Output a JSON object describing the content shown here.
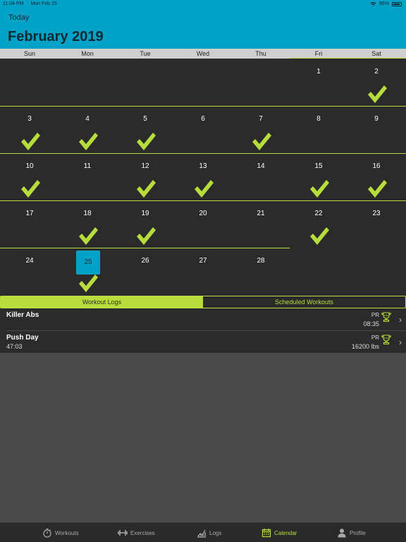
{
  "status_bar": {
    "time": "11:04 PM",
    "date": "Mon Feb 25",
    "battery": "86%",
    "battery_level": 0.86
  },
  "header": {
    "today_label": "Today",
    "month_title": "February 2019"
  },
  "calendar": {
    "weekdays": [
      "Sun",
      "Mon",
      "Tue",
      "Wed",
      "Thu",
      "Fri",
      "Sat"
    ],
    "first_weekday_index": 5,
    "days_in_month": 28,
    "today": 25,
    "completed_days": [
      2,
      3,
      4,
      5,
      7,
      10,
      12,
      13,
      15,
      16,
      18,
      19,
      22,
      25
    ],
    "check_color": "#b6dd3b",
    "today_color": "#00a2c7"
  },
  "segments": {
    "workout_logs": "Workout Logs",
    "scheduled_workouts": "Scheduled Workouts"
  },
  "logs": [
    {
      "name": "Killer Abs",
      "subtitle": "",
      "pr_label": "PR",
      "value": "08:35"
    },
    {
      "name": "Push Day",
      "subtitle": "47:03",
      "pr_label": "PR",
      "value": "16200 lbs"
    }
  ],
  "tabs": {
    "workouts": "Workouts",
    "exercises": "Exercises",
    "logs": "Logs",
    "calendar": "Calendar",
    "profile": "Profile"
  },
  "colors": {
    "accent": "#b6dd3b",
    "brand": "#00a2c7"
  }
}
